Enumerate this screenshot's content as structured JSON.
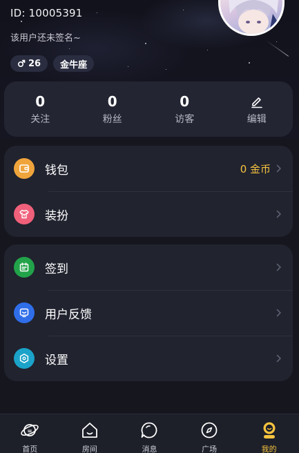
{
  "profile": {
    "user_id": "ID: 10005391",
    "signature": "该用户还未签名~",
    "gender_age": "26",
    "zodiac": "金牛座"
  },
  "stats": [
    {
      "value": "0",
      "label": "关注"
    },
    {
      "value": "0",
      "label": "粉丝"
    },
    {
      "value": "0",
      "label": "访客"
    }
  ],
  "edit_label": "编辑",
  "menu_group_1": [
    {
      "label": "钱包",
      "value": "0 金币",
      "icon": "wallet-icon",
      "color": "#f0a43c"
    },
    {
      "label": "装扮",
      "icon": "shirt-icon",
      "color": "#f0607a"
    }
  ],
  "menu_group_2": [
    {
      "label": "签到",
      "icon": "calendar-icon",
      "color": "#22a34a"
    },
    {
      "label": "用户反馈",
      "icon": "feedback-icon",
      "color": "#2f6ee8"
    },
    {
      "label": "设置",
      "icon": "settings-hex-icon",
      "color": "#1ba3c9"
    }
  ],
  "bottom_nav": [
    {
      "label": "首页",
      "icon": "planet-icon"
    },
    {
      "label": "房间",
      "icon": "house-icon"
    },
    {
      "label": "消息",
      "icon": "chat-bubble-icon"
    },
    {
      "label": "广场",
      "icon": "compass-icon"
    },
    {
      "label": "我的",
      "icon": "profile-face-icon",
      "active": true
    }
  ],
  "colors": {
    "background": "#16161f",
    "card": "#21232f",
    "accent_gold": "#f6c33f"
  }
}
